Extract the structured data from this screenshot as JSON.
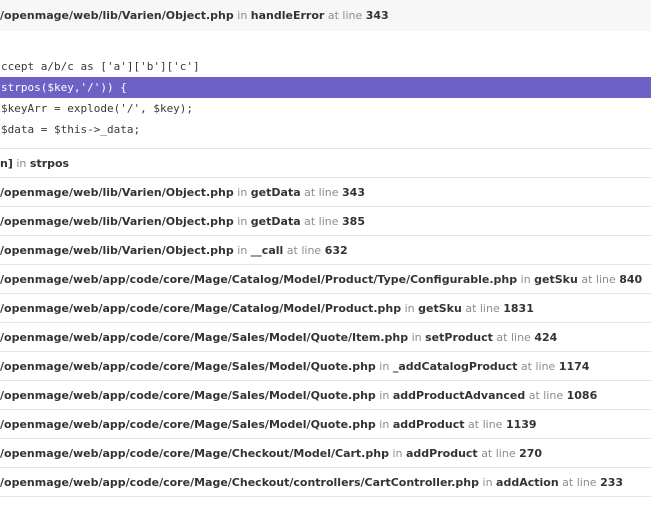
{
  "top_frame": {
    "path": "/openmage/web/lib/Varien/Object.php",
    "in_text": "in",
    "func": "handleError",
    "at_text": "at line",
    "line": "343"
  },
  "code_lines": [
    "ccept a/b/c as ['a']['b']['c']",
    "strpos($key,'/')) {",
    "$keyArr = explode('/', $key);",
    "$data = $this->_data;"
  ],
  "frames": [
    {
      "path": "n]",
      "in_text": "in",
      "func": "strpos",
      "at_text": "",
      "line": ""
    },
    {
      "path": "/openmage/web/lib/Varien/Object.php",
      "in_text": "in",
      "func": "getData",
      "at_text": "at line",
      "line": "343"
    },
    {
      "path": "/openmage/web/lib/Varien/Object.php",
      "in_text": "in",
      "func": "getData",
      "at_text": "at line",
      "line": "385"
    },
    {
      "path": "/openmage/web/lib/Varien/Object.php",
      "in_text": "in",
      "func": "__call",
      "at_text": "at line",
      "line": "632"
    },
    {
      "path": "/openmage/web/app/code/core/Mage/Catalog/Model/Product/Type/Configurable.php",
      "in_text": "in",
      "func": "getSku",
      "at_text": "at line",
      "line": "840"
    },
    {
      "path": "/openmage/web/app/code/core/Mage/Catalog/Model/Product.php",
      "in_text": "in",
      "func": "getSku",
      "at_text": "at line",
      "line": "1831"
    },
    {
      "path": "/openmage/web/app/code/core/Mage/Sales/Model/Quote/Item.php",
      "in_text": "in",
      "func": "setProduct",
      "at_text": "at line",
      "line": "424"
    },
    {
      "path": "/openmage/web/app/code/core/Mage/Sales/Model/Quote.php",
      "in_text": "in",
      "func": "_addCatalogProduct",
      "at_text": "at line",
      "line": "1174"
    },
    {
      "path": "/openmage/web/app/code/core/Mage/Sales/Model/Quote.php",
      "in_text": "in",
      "func": "addProductAdvanced",
      "at_text": "at line",
      "line": "1086"
    },
    {
      "path": "/openmage/web/app/code/core/Mage/Sales/Model/Quote.php",
      "in_text": "in",
      "func": "addProduct",
      "at_text": "at line",
      "line": "1139"
    },
    {
      "path": "/openmage/web/app/code/core/Mage/Checkout/Model/Cart.php",
      "in_text": "in",
      "func": "addProduct",
      "at_text": "at line",
      "line": "270"
    },
    {
      "path": "/openmage/web/app/code/core/Mage/Checkout/controllers/CartController.php",
      "in_text": "in",
      "func": "addAction",
      "at_text": "at line",
      "line": "233"
    }
  ]
}
